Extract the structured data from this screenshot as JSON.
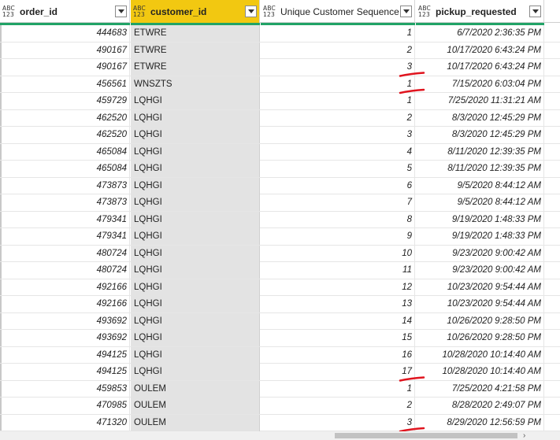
{
  "columns": [
    {
      "key": "order_id",
      "type_top": "ABC",
      "type_bottom": "123",
      "label": "order_id",
      "selected": false
    },
    {
      "key": "customer_id",
      "type_top": "ABC",
      "type_bottom": "123",
      "label": "customer_id",
      "selected": true
    },
    {
      "key": "seq",
      "type_top": "ABC",
      "type_bottom": "123",
      "label": "Unique Customer Sequence",
      "selected": false
    },
    {
      "key": "pickup",
      "type_top": "ABC",
      "type_bottom": "123",
      "label": "pickup_requested",
      "selected": false
    }
  ],
  "rows": [
    [
      "444683",
      "ETWRE",
      "1",
      "6/7/2020 2:36:35 PM"
    ],
    [
      "490167",
      "ETWRE",
      "2",
      "10/17/2020 6:43:24 PM"
    ],
    [
      "490167",
      "ETWRE",
      "3",
      "10/17/2020 6:43:24 PM"
    ],
    [
      "456561",
      "WNSZTS",
      "1",
      "7/15/2020 6:03:04 PM"
    ],
    [
      "459729",
      "LQHGI",
      "1",
      "7/25/2020 11:31:21 AM"
    ],
    [
      "462520",
      "LQHGI",
      "2",
      "8/3/2020 12:45:29 PM"
    ],
    [
      "462520",
      "LQHGI",
      "3",
      "8/3/2020 12:45:29 PM"
    ],
    [
      "465084",
      "LQHGI",
      "4",
      "8/11/2020 12:39:35 PM"
    ],
    [
      "465084",
      "LQHGI",
      "5",
      "8/11/2020 12:39:35 PM"
    ],
    [
      "473873",
      "LQHGI",
      "6",
      "9/5/2020 8:44:12 AM"
    ],
    [
      "473873",
      "LQHGI",
      "7",
      "9/5/2020 8:44:12 AM"
    ],
    [
      "479341",
      "LQHGI",
      "8",
      "9/19/2020 1:48:33 PM"
    ],
    [
      "479341",
      "LQHGI",
      "9",
      "9/19/2020 1:48:33 PM"
    ],
    [
      "480724",
      "LQHGI",
      "10",
      "9/23/2020 9:00:42 AM"
    ],
    [
      "480724",
      "LQHGI",
      "11",
      "9/23/2020 9:00:42 AM"
    ],
    [
      "492166",
      "LQHGI",
      "12",
      "10/23/2020 9:54:44 AM"
    ],
    [
      "492166",
      "LQHGI",
      "13",
      "10/23/2020 9:54:44 AM"
    ],
    [
      "493692",
      "LQHGI",
      "14",
      "10/26/2020 9:28:50 PM"
    ],
    [
      "493692",
      "LQHGI",
      "15",
      "10/26/2020 9:28:50 PM"
    ],
    [
      "494125",
      "LQHGI",
      "16",
      "10/28/2020 10:14:40 AM"
    ],
    [
      "494125",
      "LQHGI",
      "17",
      "10/28/2020 10:14:40 AM"
    ],
    [
      "459853",
      "OULEM",
      "1",
      "7/25/2020 4:21:58 PM"
    ],
    [
      "470985",
      "OULEM",
      "2",
      "8/28/2020 2:49:07 PM"
    ],
    [
      "471320",
      "OULEM",
      "3",
      "8/29/2020 12:56:59 PM"
    ]
  ],
  "annotations": {
    "stroke_color": "#e0141e",
    "underlined_rows": [
      2,
      3,
      20,
      23
    ]
  },
  "colors": {
    "selected_header": "#f2c811",
    "selected_column": "#e3e3e3",
    "quality_bar": "#21a366"
  },
  "icons": {
    "filter": "chevron-down-icon",
    "scroll_right": "chevron-right-icon"
  }
}
